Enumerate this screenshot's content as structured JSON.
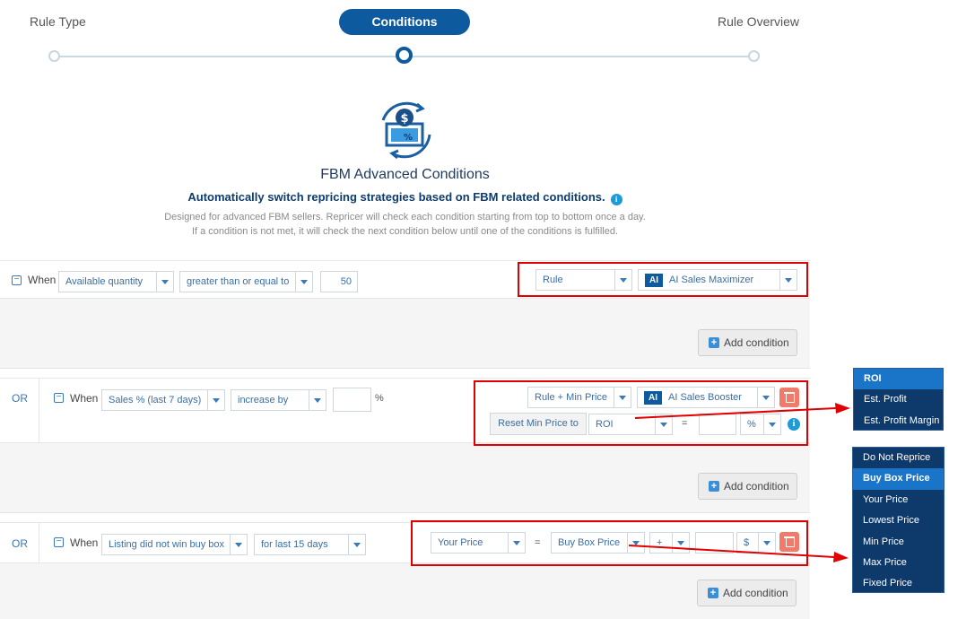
{
  "stepper": {
    "steps": [
      "Rule Type",
      "Conditions",
      "Rule Overview"
    ]
  },
  "header": {
    "title": "FBM Advanced Conditions",
    "subtitle": "Automatically switch repricing strategies based on FBM related conditions.",
    "info_icon": "i",
    "desc1": "Designed for advanced FBM sellers. Repricer will check each condition starting from top to bottom once a day.",
    "desc2": "If a condition is not met, it will check the next condition below until one of the conditions is fulfilled."
  },
  "row1": {
    "when": "When",
    "field": "Available quantity",
    "operator": "greater than or equal to",
    "value": "50",
    "action": "Rule",
    "ai_badge": "AI",
    "strategy": "AI Sales Maximizer",
    "add_condition": "Add condition"
  },
  "row2": {
    "or": "OR",
    "when": "When",
    "field": "Sales % (last 7 days)",
    "operator": "increase by",
    "value": "",
    "percent": "%",
    "action": "Rule + Min Price",
    "ai_badge": "AI",
    "strategy": "AI Sales Booster",
    "reset_label": "Reset Min Price to",
    "reset_field": "ROI",
    "eq": "=",
    "reset_value": "",
    "unit": "%",
    "info": "i",
    "add_condition": "Add condition"
  },
  "row3": {
    "or": "OR",
    "when": "When",
    "field": "Listing did not win buy box",
    "period": "for last 15 days",
    "target": "Your Price",
    "eq": "=",
    "source": "Buy Box Price",
    "sign": "+",
    "value": "",
    "unit": "$",
    "add_condition": "Add condition"
  },
  "dropdown_roi": {
    "items": [
      "ROI",
      "Est. Profit",
      "Est. Profit Margin"
    ],
    "selected": "ROI"
  },
  "dropdown_price": {
    "items": [
      "Do Not Reprice",
      "Buy Box Price",
      "Your Price",
      "Lowest Price",
      "Min Price",
      "Max Price",
      "Fixed Price"
    ],
    "selected": "Buy Box Price"
  },
  "colors": {
    "primary": "#0d5a9e",
    "highlight": "#e00000",
    "dropdown_bg": "#0e3a6b",
    "dropdown_selected": "#1a75c9",
    "delete": "#f07b6b"
  }
}
